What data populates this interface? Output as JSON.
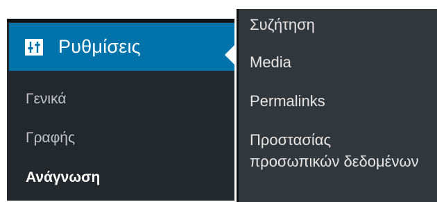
{
  "sidebar": {
    "active": {
      "icon": "settings-sliders-icon",
      "label": "Ρυθμίσεις"
    },
    "submenu": [
      {
        "label": "Γενικά"
      },
      {
        "label": "Γραφής"
      },
      {
        "label": "Ανάγνωση"
      }
    ],
    "current_index": 2
  },
  "flyout": {
    "items": [
      {
        "label": "Συζήτηση"
      },
      {
        "label": "Media"
      },
      {
        "label": "Permalinks"
      },
      {
        "label": "Προστασίας προσωπικών δεδομένων"
      }
    ]
  },
  "colors": {
    "sidebar_bg": "#23282d",
    "flyout_bg": "#32373c",
    "active_bg": "#0073aa",
    "text_muted": "#c3c4c7",
    "text_white": "#ffffff"
  }
}
